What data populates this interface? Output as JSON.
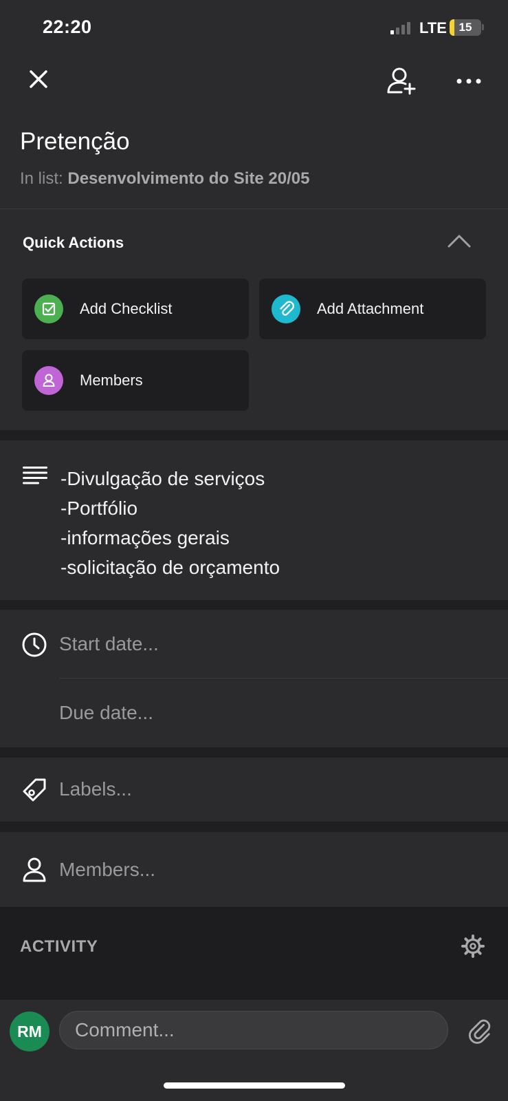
{
  "status_bar": {
    "time": "22:20",
    "network": "LTE",
    "battery": "15"
  },
  "card": {
    "title": "Pretenção",
    "in_list_prefix": "In list:",
    "in_list_name": "Desenvolvimento do Site 20/05"
  },
  "quick_actions": {
    "heading": "Quick Actions",
    "buttons": [
      {
        "label": "Add Checklist",
        "icon": "checklist-icon",
        "color": "#4caf50"
      },
      {
        "label": "Add Attachment",
        "icon": "paperclip-icon",
        "color": "#1eb8cf"
      },
      {
        "label": "Members",
        "icon": "person-icon",
        "color": "#c065d6"
      }
    ]
  },
  "description": {
    "lines": [
      "-Divulgação de serviços",
      "-Portfólio",
      "-informações gerais",
      "-solicitação de orçamento"
    ]
  },
  "dates": {
    "start_placeholder": "Start date...",
    "due_placeholder": "Due date..."
  },
  "labels": {
    "placeholder": "Labels..."
  },
  "members": {
    "placeholder": "Members..."
  },
  "activity": {
    "heading": "ACTIVITY"
  },
  "comment": {
    "avatar_initials": "RM",
    "placeholder": "Comment..."
  }
}
